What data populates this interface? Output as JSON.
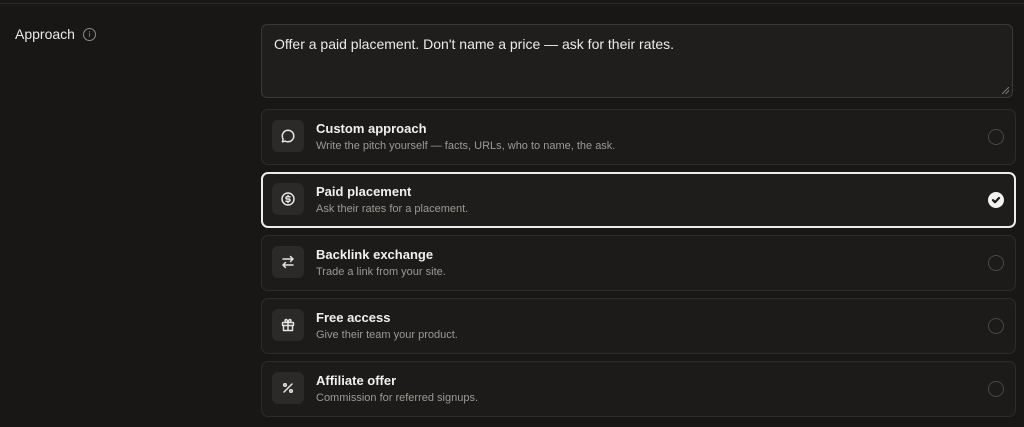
{
  "field": {
    "label": "Approach",
    "info_icon": "info-icon",
    "value": "Offer a paid placement. Don't name a price — ask for their rates."
  },
  "options": [
    {
      "title": "Custom approach",
      "description": "Write the pitch yourself — facts, URLs, who to name, the ask.",
      "icon": "chat-bubble-icon",
      "selected": false
    },
    {
      "title": "Paid placement",
      "description": "Ask their rates for a placement.",
      "icon": "dollar-circle-icon",
      "selected": true
    },
    {
      "title": "Backlink exchange",
      "description": "Trade a link from your site.",
      "icon": "swap-arrows-icon",
      "selected": false
    },
    {
      "title": "Free access",
      "description": "Give their team your product.",
      "icon": "gift-icon",
      "selected": false
    },
    {
      "title": "Affiliate offer",
      "description": "Commission for referred signups.",
      "icon": "percent-icon",
      "selected": false
    }
  ],
  "colors": {
    "background": "#181716",
    "card": "#1c1b1a",
    "selected_border": "#ececec"
  }
}
